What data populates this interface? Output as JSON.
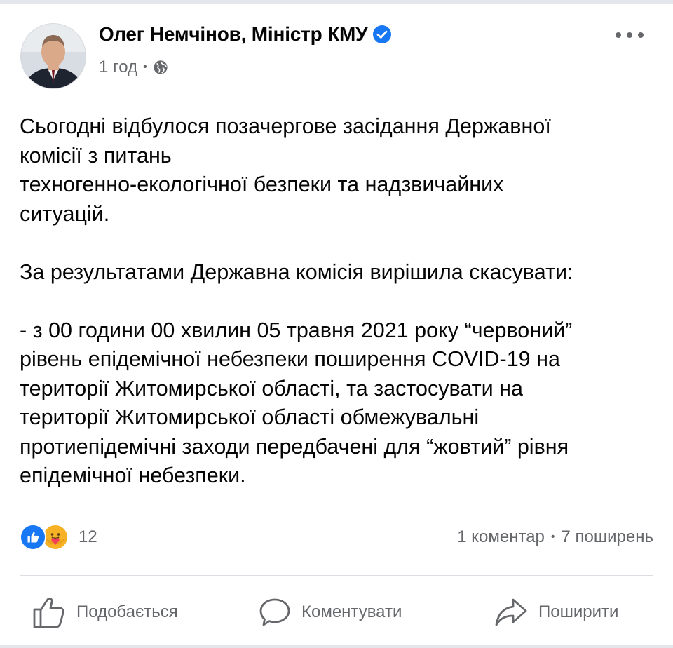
{
  "post": {
    "author": "Олег Немчінов, Міністр КМУ",
    "time": "1 год",
    "paragraphs": [
      [
        "Сьогодні відбулося позачергове засідання Державної",
        "комісії з питань",
        "техногенно-екологічної безпеки та надзвичайних",
        "ситуацій."
      ],
      [
        "За результатами Державна комісія вирішила скасувати:"
      ],
      [
        "- з 00 години 00 хвилин 05 травня 2021 року “червоний”",
        "рівень епідемічної небезпеки поширення COVID-19 на",
        "території Житомирської області, та застосувати на",
        "території Житомирської області обмежувальні",
        "протиепідемічні заходи передбачені для “жовтий” рівня",
        "епідемічної небезпеки."
      ]
    ],
    "reactions_count": "12",
    "comments": "1 коментар",
    "shares": "7 поширень"
  },
  "actions": {
    "like": "Подобається",
    "comment": "Коментувати",
    "share": "Поширити"
  },
  "icons": [
    "verified-icon",
    "globe-icon",
    "more-icon",
    "like-reaction-icon",
    "care-reaction-icon",
    "thumbs-up-icon",
    "comment-icon",
    "share-icon"
  ],
  "colors": {
    "facebook_blue": "#1877f2",
    "muted": "#65676b"
  }
}
